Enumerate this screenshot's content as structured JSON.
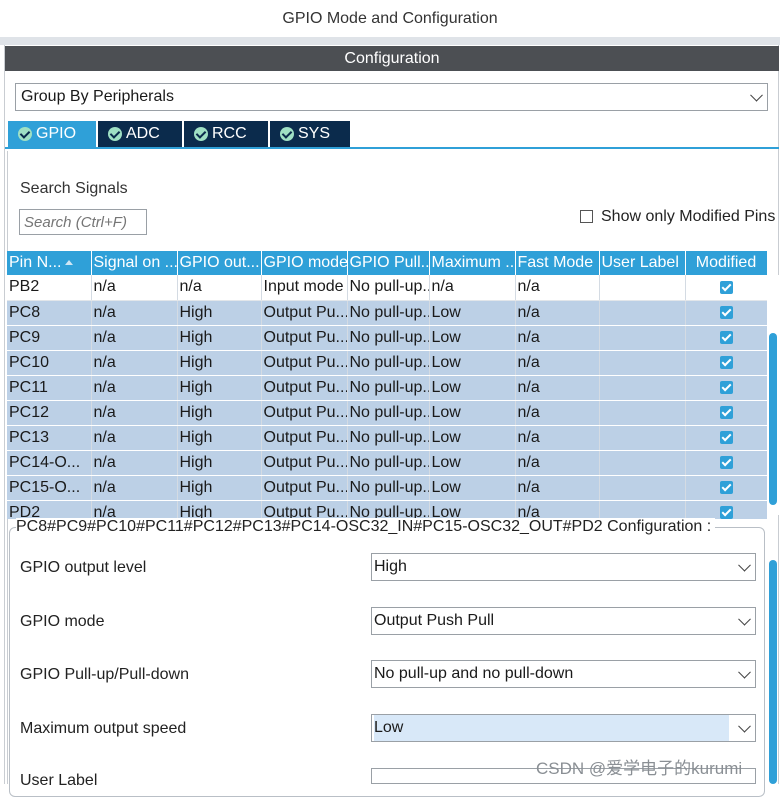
{
  "window_title": "GPIO Mode and Configuration",
  "config_header": "Configuration",
  "group_select": {
    "value": "Group By Peripherals"
  },
  "tabs": [
    {
      "label": "GPIO",
      "active": true
    },
    {
      "label": "ADC",
      "active": false
    },
    {
      "label": "RCC",
      "active": false
    },
    {
      "label": "SYS",
      "active": false
    }
  ],
  "search": {
    "label": "Search Signals",
    "placeholder": "Search (Ctrl+F)"
  },
  "modified_filter": {
    "label": "Show only Modified Pins",
    "checked": false
  },
  "table": {
    "columns": [
      "Pin N...",
      "Signal on ...",
      "GPIO out...",
      "GPIO mode",
      "GPIO Pull...",
      "Maximum ...",
      "Fast Mode",
      "User Label",
      "Modified"
    ],
    "rows": [
      {
        "pin": "PB2",
        "signal": "n/a",
        "output": "n/a",
        "mode": "Input mode",
        "pull": "No pull-up...",
        "speed": "n/a",
        "fast": "n/a",
        "label": "",
        "modified": true,
        "selected": false
      },
      {
        "pin": "PC8",
        "signal": "n/a",
        "output": "High",
        "mode": "Output Pu...",
        "pull": "No pull-up...",
        "speed": "Low",
        "fast": "n/a",
        "label": "",
        "modified": true,
        "selected": true
      },
      {
        "pin": "PC9",
        "signal": "n/a",
        "output": "High",
        "mode": "Output Pu...",
        "pull": "No pull-up...",
        "speed": "Low",
        "fast": "n/a",
        "label": "",
        "modified": true,
        "selected": true
      },
      {
        "pin": "PC10",
        "signal": "n/a",
        "output": "High",
        "mode": "Output Pu...",
        "pull": "No pull-up...",
        "speed": "Low",
        "fast": "n/a",
        "label": "",
        "modified": true,
        "selected": true
      },
      {
        "pin": "PC11",
        "signal": "n/a",
        "output": "High",
        "mode": "Output Pu...",
        "pull": "No pull-up...",
        "speed": "Low",
        "fast": "n/a",
        "label": "",
        "modified": true,
        "selected": true
      },
      {
        "pin": "PC12",
        "signal": "n/a",
        "output": "High",
        "mode": "Output Pu...",
        "pull": "No pull-up...",
        "speed": "Low",
        "fast": "n/a",
        "label": "",
        "modified": true,
        "selected": true
      },
      {
        "pin": "PC13",
        "signal": "n/a",
        "output": "High",
        "mode": "Output Pu...",
        "pull": "No pull-up...",
        "speed": "Low",
        "fast": "n/a",
        "label": "",
        "modified": true,
        "selected": true
      },
      {
        "pin": "PC14-O...",
        "signal": "n/a",
        "output": "High",
        "mode": "Output Pu...",
        "pull": "No pull-up...",
        "speed": "Low",
        "fast": "n/a",
        "label": "",
        "modified": true,
        "selected": true
      },
      {
        "pin": "PC15-O...",
        "signal": "n/a",
        "output": "High",
        "mode": "Output Pu...",
        "pull": "No pull-up...",
        "speed": "Low",
        "fast": "n/a",
        "label": "",
        "modified": true,
        "selected": true
      },
      {
        "pin": "PD2",
        "signal": "n/a",
        "output": "High",
        "mode": "Output Pu...",
        "pull": "No pull-up...",
        "speed": "Low",
        "fast": "n/a",
        "label": "",
        "modified": true,
        "selected": true
      }
    ]
  },
  "config_group": {
    "title": "PC8#PC9#PC10#PC11#PC12#PC13#PC14-OSC32_IN#PC15-OSC32_OUT#PD2 Configuration :",
    "properties": [
      {
        "label": "GPIO output level",
        "value": "High"
      },
      {
        "label": "GPIO mode",
        "value": "Output Push Pull"
      },
      {
        "label": "GPIO Pull-up/Pull-down",
        "value": "No pull-up and no pull-down"
      },
      {
        "label": "Maximum output speed",
        "value": "Low"
      },
      {
        "label": "User Label",
        "value": ""
      }
    ]
  },
  "watermark": "CSDN @爱学电子的kurumi",
  "colors": {
    "accent": "#2fa0d8",
    "tab_bg": "#0b2b4c",
    "selection": "#bcd0e6",
    "header_bar": "#4c4f53"
  }
}
